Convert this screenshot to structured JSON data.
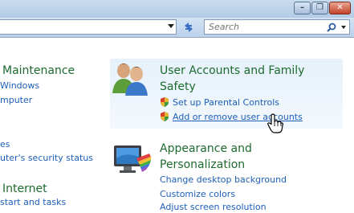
{
  "search": {
    "placeholder": "Search"
  },
  "left_column": {
    "maintenance": {
      "title": "Maintenance",
      "link1": "Windows",
      "link2": "mputer"
    },
    "security": {
      "link1": "es",
      "link2": "uter's security status"
    },
    "internet": {
      "title": "Internet",
      "link1": "start and tasks"
    }
  },
  "user_accounts": {
    "title_line1": "User Accounts and Family",
    "title_line2": "Safety",
    "links": [
      "Set up Parental Controls",
      "Add or remove user accounts"
    ]
  },
  "appearance": {
    "title_line1": "Appearance and",
    "title_line2": "Personalization",
    "links": [
      "Change desktop background",
      "Customize colors",
      "Adjust screen resolution"
    ]
  },
  "colors": {
    "heading": "#1d6b2e",
    "link": "#1d5fb8",
    "hover_panel": "#e6f1fb"
  }
}
